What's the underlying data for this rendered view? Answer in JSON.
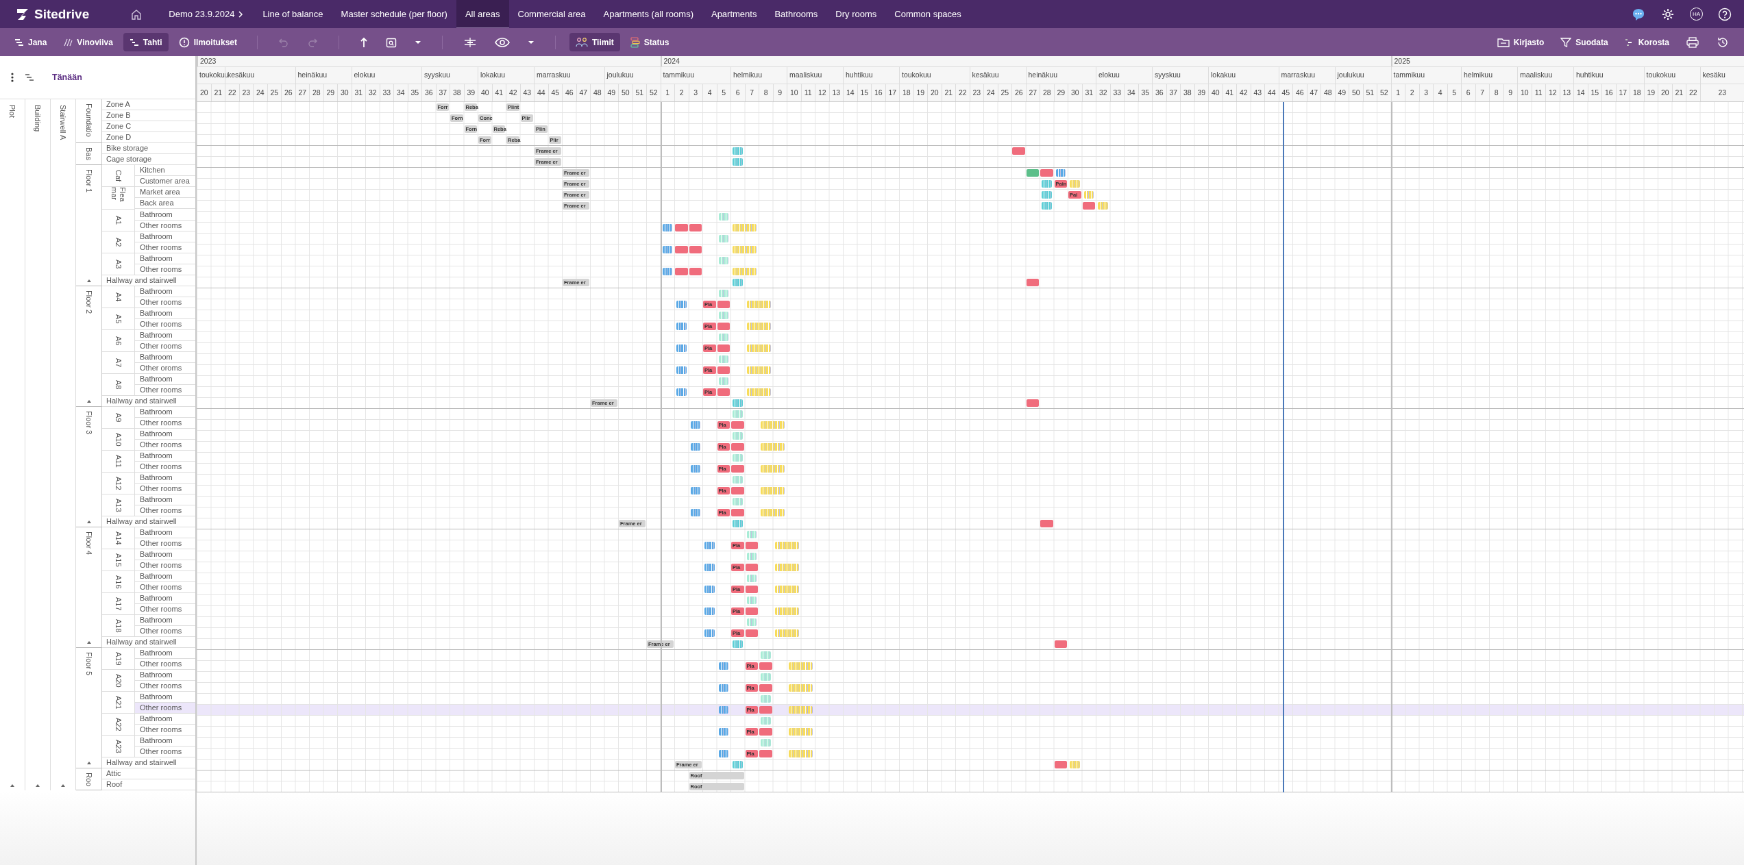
{
  "nav": {
    "logo": "Sitedrive",
    "project": "Demo 23.9.2024",
    "avatar": "HA",
    "tabs": [
      {
        "label": "Line of balance",
        "selected": false
      },
      {
        "label": "Master schedule (per floor)",
        "selected": false
      },
      {
        "label": "All areas",
        "selected": true
      },
      {
        "label": "Commercial area",
        "selected": false
      },
      {
        "label": "Apartments (all rooms)",
        "selected": false
      },
      {
        "label": "Apartments",
        "selected": false
      },
      {
        "label": "Bathrooms",
        "selected": false
      },
      {
        "label": "Dry rooms",
        "selected": false
      },
      {
        "label": "Common spaces",
        "selected": false
      }
    ]
  },
  "toolbar": {
    "views": [
      {
        "label": "Jana",
        "selected": false
      },
      {
        "label": "Vinoviiva",
        "selected": false
      },
      {
        "label": "Tahti",
        "selected": true
      },
      {
        "label": "Ilmoitukset",
        "selected": false
      }
    ],
    "undo": {
      "disabled": true
    },
    "redo": {
      "disabled": true
    },
    "filters": [
      {
        "label": "Tiimit",
        "selected": true
      },
      {
        "label": "Status",
        "selected": false
      }
    ],
    "right": [
      "Kirjasto",
      "Suodata",
      "Korosta"
    ]
  },
  "today_label": "Tänään",
  "timeline": [
    {
      "year": "2023",
      "months": [
        {
          "label": "toukokuu",
          "weeks": [
            "20",
            "21"
          ]
        },
        {
          "label": "kesäkuu",
          "weeks": [
            "22",
            "23",
            "24",
            "25",
            "26"
          ]
        },
        {
          "label": "heinäkuu",
          "weeks": [
            "27",
            "28",
            "29",
            "30"
          ]
        },
        {
          "label": "elokuu",
          "weeks": [
            "31",
            "32",
            "33",
            "34",
            "35"
          ]
        },
        {
          "label": "syyskuu",
          "weeks": [
            "36",
            "37",
            "38",
            "39"
          ]
        },
        {
          "label": "lokakuu",
          "weeks": [
            "40",
            "41",
            "42",
            "43"
          ]
        },
        {
          "label": "marraskuu",
          "weeks": [
            "44",
            "45",
            "46",
            "47",
            "48"
          ]
        },
        {
          "label": "joulukuu",
          "weeks": [
            "49",
            "50",
            "51",
            "52"
          ]
        }
      ]
    },
    {
      "year": "2024",
      "months": [
        {
          "label": "tammikuu",
          "weeks": [
            "1",
            "2",
            "3",
            "4",
            "5"
          ]
        },
        {
          "label": "helmikuu",
          "weeks": [
            "6",
            "7",
            "8",
            "9"
          ]
        },
        {
          "label": "maaliskuu",
          "weeks": [
            "10",
            "11",
            "12",
            "13"
          ]
        },
        {
          "label": "huhtikuu",
          "weeks": [
            "14",
            "15",
            "16",
            "17"
          ]
        },
        {
          "label": "toukokuu",
          "weeks": [
            "18",
            "19",
            "20",
            "21",
            "22"
          ]
        },
        {
          "label": "kesäkuu",
          "weeks": [
            "23",
            "24",
            "25",
            "26"
          ]
        },
        {
          "label": "heinäkuu",
          "weeks": [
            "27",
            "28",
            "29",
            "30",
            "31"
          ]
        },
        {
          "label": "elokuu",
          "weeks": [
            "32",
            "33",
            "34",
            "35"
          ]
        },
        {
          "label": "syyskuu",
          "weeks": [
            "36",
            "37",
            "38",
            "39"
          ]
        },
        {
          "label": "lokakuu",
          "weeks": [
            "40",
            "41",
            "42",
            "43",
            "44"
          ]
        },
        {
          "label": "marraskuu",
          "weeks": [
            "45",
            "46",
            "47",
            "48"
          ]
        },
        {
          "label": "joulukuu",
          "weeks": [
            "49",
            "50",
            "51",
            "52"
          ]
        }
      ]
    },
    {
      "year": "2025",
      "months": [
        {
          "label": "tammikuu",
          "weeks": [
            "1",
            "2",
            "3",
            "4",
            "5"
          ]
        },
        {
          "label": "helmikuu",
          "weeks": [
            "6",
            "7",
            "8",
            "9"
          ]
        },
        {
          "label": "maaliskuu",
          "weeks": [
            "10",
            "11",
            "12",
            "13"
          ]
        },
        {
          "label": "huhtikuu",
          "weeks": [
            "14",
            "15",
            "16",
            "17",
            "18"
          ]
        },
        {
          "label": "toukokuu",
          "weeks": [
            "19",
            "20",
            "21",
            "22"
          ]
        },
        {
          "label": "kesäku",
          "weeks": [
            "23"
          ]
        }
      ]
    }
  ],
  "tree": {
    "plot": "Plot",
    "building": "Building",
    "stairwell": "Stairwell A",
    "levels": [
      {
        "name": "Foundatio",
        "children": [
          {
            "name": "Zone A",
            "selected": false,
            "bars": [
              {
                "kind": "task",
                "color": "#d4d4d4",
                "label": "Forr"
              },
              {
                "kind": "task",
                "color": "#d4d4d4",
                "label": "Reba"
              },
              {
                "kind": "task",
                "color": "#d4d4d4",
                "label": "Plint"
              }
            ]
          },
          {
            "name": "Zone B",
            "selected": false,
            "bars": [
              {
                "kind": "task",
                "color": "#d4d4d4",
                "label": "Forn"
              },
              {
                "kind": "task",
                "color": "#d4d4d4",
                "label": "Conc"
              },
              {
                "kind": "task",
                "color": "#d4d4d4",
                "label": "Plir"
              }
            ]
          },
          {
            "name": "Zone C",
            "selected": false,
            "bars": [
              {
                "kind": "task",
                "color": "#d4d4d4",
                "label": "Forn"
              },
              {
                "kind": "task",
                "color": "#d4d4d4",
                "label": "Reba"
              },
              {
                "kind": "task",
                "color": "#d4d4d4",
                "label": "Plin"
              }
            ]
          },
          {
            "name": "Zone D",
            "selected": false,
            "bars": [
              {
                "kind": "task",
                "color": "#d4d4d4",
                "label": "Forr"
              },
              {
                "kind": "task",
                "color": "#d4d4d4",
                "label": "Reba"
              },
              {
                "kind": "task",
                "color": "#d4d4d4",
                "label": "Plir"
              }
            ]
          }
        ]
      },
      {
        "name": "Bas",
        "children": [
          {
            "name": "Bike storage",
            "selected": false,
            "bars": [
              {
                "kind": "task",
                "color": "#d4d4d4",
                "label": "Frame er"
              },
              {
                "kind": "stripes",
                "color": "#5ccfd6"
              },
              {
                "kind": "task",
                "color": "#f06c7c"
              }
            ]
          },
          {
            "name": "Cage storage",
            "selected": false,
            "bars": [
              {
                "kind": "task",
                "color": "#d4d4d4",
                "label": "Frame er"
              },
              {
                "kind": "stripes",
                "color": "#5ccfd6"
              }
            ]
          }
        ]
      },
      {
        "name": "Floor 1",
        "children": [
          {
            "name": "Caf",
            "children": [
              {
                "name": "Kitchen",
                "selected": false,
                "bars": [
                  {
                    "kind": "task",
                    "color": "#d4d4d4",
                    "label": "Frame er"
                  },
                  {
                    "kind": "task",
                    "color": "#5cbf8a"
                  },
                  {
                    "kind": "task",
                    "color": "#f06c7c"
                  },
                  {
                    "kind": "stripes",
                    "color": "#5aa9e6"
                  }
                ]
              },
              {
                "name": "Customer area",
                "selected": false,
                "bars": [
                  {
                    "kind": "task",
                    "color": "#d4d4d4",
                    "label": "Frame er"
                  },
                  {
                    "kind": "stripes",
                    "color": "#5ccfd6"
                  },
                  {
                    "kind": "task",
                    "color": "#f06c7c",
                    "label": "Pain"
                  },
                  {
                    "kind": "stripes",
                    "color": "#f7dc5c"
                  }
                ]
              }
            ]
          },
          {
            "name": "Flea mar",
            "children": [
              {
                "name": "Market area",
                "selected": false,
                "bars": [
                  {
                    "kind": "task",
                    "color": "#d4d4d4",
                    "label": "Frame er"
                  },
                  {
                    "kind": "stripes",
                    "color": "#5ccfd6"
                  },
                  {
                    "kind": "task",
                    "color": "#f06c7c",
                    "label": "Pai"
                  },
                  {
                    "kind": "stripes",
                    "color": "#f7dc5c"
                  }
                ]
              },
              {
                "name": "Back area",
                "selected": false,
                "bars": [
                  {
                    "kind": "task",
                    "color": "#d4d4d4",
                    "label": "Frame er"
                  },
                  {
                    "kind": "stripes",
                    "color": "#5ccfd6"
                  },
                  {
                    "kind": "task",
                    "color": "#f06c7c"
                  },
                  {
                    "kind": "stripes",
                    "color": "#f7dc5c"
                  }
                ]
              }
            ]
          },
          {
            "name": "A1",
            "children": [
              {
                "name": "Bathroom",
                "selected": false,
                "bars": [
                  {
                    "kind": "stripes",
                    "color": "#a8ecd6"
                  }
                ]
              },
              {
                "name": "Other rooms",
                "selected": false,
                "bars": [
                  {
                    "kind": "stripes",
                    "color": "#5aa9e6"
                  },
                  {
                    "kind": "task",
                    "color": "#f06c7c"
                  },
                  {
                    "kind": "task",
                    "color": "#f06c7c"
                  },
                  {
                    "kind": "stripes",
                    "color": "#f7dc5c"
                  }
                ]
              }
            ]
          },
          {
            "name": "A2",
            "children": [
              {
                "name": "Bathroom",
                "selected": false,
                "bars": [
                  {
                    "kind": "stripes",
                    "color": "#a8ecd6"
                  }
                ]
              },
              {
                "name": "Other rooms",
                "selected": false,
                "bars": [
                  {
                    "kind": "stripes",
                    "color": "#5aa9e6"
                  },
                  {
                    "kind": "task",
                    "color": "#f06c7c"
                  },
                  {
                    "kind": "task",
                    "color": "#f06c7c"
                  },
                  {
                    "kind": "stripes",
                    "color": "#f7dc5c"
                  }
                ]
              }
            ]
          },
          {
            "name": "A3",
            "children": [
              {
                "name": "Bathroom",
                "selected": false,
                "bars": [
                  {
                    "kind": "stripes",
                    "color": "#a8ecd6"
                  }
                ]
              },
              {
                "name": "Other rooms",
                "selected": false,
                "bars": [
                  {
                    "kind": "stripes",
                    "color": "#5aa9e6"
                  },
                  {
                    "kind": "task",
                    "color": "#f06c7c"
                  },
                  {
                    "kind": "task",
                    "color": "#f06c7c"
                  },
                  {
                    "kind": "stripes",
                    "color": "#f7dc5c"
                  }
                ]
              }
            ]
          },
          {
            "name": "Hallway and stairwell",
            "selected": false,
            "bars": [
              {
                "kind": "task",
                "color": "#d4d4d4",
                "label": "Frame er"
              },
              {
                "kind": "stripes",
                "color": "#5ccfd6"
              },
              {
                "kind": "task",
                "color": "#f06c7c"
              }
            ]
          }
        ]
      },
      {
        "name": "Floor 2",
        "children": [
          {
            "name": "A4",
            "children": [
              {
                "name": "Bathroom",
                "selected": false,
                "bars": [
                  {
                    "kind": "stripes",
                    "color": "#a8ecd6"
                  }
                ]
              },
              {
                "name": "Other rooms",
                "selected": false,
                "bars": [
                  {
                    "kind": "stripes",
                    "color": "#5aa9e6"
                  },
                  {
                    "kind": "task",
                    "color": "#f06c7c",
                    "label": "Pla"
                  },
                  {
                    "kind": "task",
                    "color": "#f06c7c"
                  },
                  {
                    "kind": "stripes",
                    "color": "#f7dc5c"
                  }
                ]
              }
            ]
          },
          {
            "name": "A5",
            "children": [
              {
                "name": "Bathroom",
                "selected": false,
                "bars": [
                  {
                    "kind": "stripes",
                    "color": "#a8ecd6"
                  }
                ]
              },
              {
                "name": "Other rooms",
                "selected": false,
                "bars": [
                  {
                    "kind": "stripes",
                    "color": "#5aa9e6"
                  },
                  {
                    "kind": "task",
                    "color": "#f06c7c",
                    "label": "Pla"
                  },
                  {
                    "kind": "task",
                    "color": "#f06c7c"
                  },
                  {
                    "kind": "stripes",
                    "color": "#f7dc5c"
                  }
                ]
              }
            ]
          },
          {
            "name": "A6",
            "children": [
              {
                "name": "Bathroom",
                "selected": false,
                "bars": [
                  {
                    "kind": "stripes",
                    "color": "#a8ecd6"
                  }
                ]
              },
              {
                "name": "Other rooms",
                "selected": false,
                "bars": [
                  {
                    "kind": "stripes",
                    "color": "#5aa9e6"
                  },
                  {
                    "kind": "task",
                    "color": "#f06c7c",
                    "label": "Pla"
                  },
                  {
                    "kind": "task",
                    "color": "#f06c7c"
                  },
                  {
                    "kind": "stripes",
                    "color": "#f7dc5c"
                  }
                ]
              }
            ]
          },
          {
            "name": "A7",
            "children": [
              {
                "name": "Bathroom",
                "selected": false,
                "bars": [
                  {
                    "kind": "stripes",
                    "color": "#a8ecd6"
                  }
                ]
              },
              {
                "name": "Other oroms",
                "selected": false,
                "bars": [
                  {
                    "kind": "stripes",
                    "color": "#5aa9e6"
                  },
                  {
                    "kind": "task",
                    "color": "#f06c7c",
                    "label": "Pla"
                  },
                  {
                    "kind": "task",
                    "color": "#f06c7c"
                  },
                  {
                    "kind": "stripes",
                    "color": "#f7dc5c"
                  }
                ]
              }
            ]
          },
          {
            "name": "A8",
            "children": [
              {
                "name": "Bathroom",
                "selected": false,
                "bars": [
                  {
                    "kind": "stripes",
                    "color": "#a8ecd6"
                  }
                ]
              },
              {
                "name": "Other rooms",
                "selected": false,
                "bars": [
                  {
                    "kind": "stripes",
                    "color": "#5aa9e6"
                  },
                  {
                    "kind": "task",
                    "color": "#f06c7c",
                    "label": "Pla"
                  },
                  {
                    "kind": "task",
                    "color": "#f06c7c"
                  },
                  {
                    "kind": "stripes",
                    "color": "#f7dc5c"
                  }
                ]
              }
            ]
          },
          {
            "name": "Hallway and stairwell",
            "selected": false,
            "bars": [
              {
                "kind": "task",
                "color": "#d4d4d4",
                "label": "Frame er"
              },
              {
                "kind": "stripes",
                "color": "#5ccfd6"
              },
              {
                "kind": "task",
                "color": "#f06c7c"
              }
            ]
          }
        ]
      },
      {
        "name": "Floor 3",
        "children": [
          {
            "name": "A9",
            "children": [
              {
                "name": "Bathroom",
                "selected": false,
                "bars": [
                  {
                    "kind": "stripes",
                    "color": "#a8ecd6"
                  }
                ]
              },
              {
                "name": "Other rooms",
                "selected": false,
                "bars": [
                  {
                    "kind": "stripes",
                    "color": "#5aa9e6"
                  },
                  {
                    "kind": "task",
                    "color": "#f06c7c",
                    "label": "Pla"
                  },
                  {
                    "kind": "task",
                    "color": "#f06c7c"
                  },
                  {
                    "kind": "stripes",
                    "color": "#f7dc5c"
                  }
                ]
              }
            ]
          },
          {
            "name": "A10",
            "children": [
              {
                "name": "Bathroom",
                "selected": false,
                "bars": [
                  {
                    "kind": "stripes",
                    "color": "#a8ecd6"
                  }
                ]
              },
              {
                "name": "Other rooms",
                "selected": false,
                "bars": [
                  {
                    "kind": "stripes",
                    "color": "#5aa9e6"
                  },
                  {
                    "kind": "task",
                    "color": "#f06c7c",
                    "label": "Pla"
                  },
                  {
                    "kind": "task",
                    "color": "#f06c7c"
                  },
                  {
                    "kind": "stripes",
                    "color": "#f7dc5c"
                  }
                ]
              }
            ]
          },
          {
            "name": "A11",
            "children": [
              {
                "name": "Bathroom",
                "selected": false,
                "bars": [
                  {
                    "kind": "stripes",
                    "color": "#a8ecd6"
                  }
                ]
              },
              {
                "name": "Other rooms",
                "selected": false,
                "bars": [
                  {
                    "kind": "stripes",
                    "color": "#5aa9e6"
                  },
                  {
                    "kind": "task",
                    "color": "#f06c7c",
                    "label": "Pla"
                  },
                  {
                    "kind": "task",
                    "color": "#f06c7c"
                  },
                  {
                    "kind": "stripes",
                    "color": "#f7dc5c"
                  }
                ]
              }
            ]
          },
          {
            "name": "A12",
            "children": [
              {
                "name": "Bathroom",
                "selected": false,
                "bars": [
                  {
                    "kind": "stripes",
                    "color": "#a8ecd6"
                  }
                ]
              },
              {
                "name": "Other rooms",
                "selected": false,
                "bars": [
                  {
                    "kind": "stripes",
                    "color": "#5aa9e6"
                  },
                  {
                    "kind": "task",
                    "color": "#f06c7c",
                    "label": "Pla"
                  },
                  {
                    "kind": "task",
                    "color": "#f06c7c"
                  },
                  {
                    "kind": "stripes",
                    "color": "#f7dc5c"
                  }
                ]
              }
            ]
          },
          {
            "name": "A13",
            "children": [
              {
                "name": "Bathroom",
                "selected": false,
                "bars": [
                  {
                    "kind": "stripes",
                    "color": "#a8ecd6"
                  }
                ]
              },
              {
                "name": "Other rooms",
                "selected": false,
                "bars": [
                  {
                    "kind": "stripes",
                    "color": "#5aa9e6"
                  },
                  {
                    "kind": "task",
                    "color": "#f06c7c",
                    "label": "Pla"
                  },
                  {
                    "kind": "task",
                    "color": "#f06c7c"
                  },
                  {
                    "kind": "stripes",
                    "color": "#f7dc5c"
                  }
                ]
              }
            ]
          },
          {
            "name": "Hallway and stairwell",
            "selected": false,
            "bars": [
              {
                "kind": "task",
                "color": "#d4d4d4",
                "label": "Frame er"
              },
              {
                "kind": "stripes",
                "color": "#5ccfd6"
              },
              {
                "kind": "task",
                "color": "#f06c7c"
              }
            ]
          }
        ]
      },
      {
        "name": "Floor 4",
        "children": [
          {
            "name": "A14",
            "children": [
              {
                "name": "Bathroom",
                "selected": false,
                "bars": [
                  {
                    "kind": "stripes",
                    "color": "#a8ecd6"
                  }
                ]
              },
              {
                "name": "Other rooms",
                "selected": false,
                "bars": [
                  {
                    "kind": "stripes",
                    "color": "#5aa9e6"
                  },
                  {
                    "kind": "task",
                    "color": "#f06c7c",
                    "label": "Pla"
                  },
                  {
                    "kind": "task",
                    "color": "#f06c7c"
                  },
                  {
                    "kind": "stripes",
                    "color": "#f7dc5c"
                  }
                ]
              }
            ]
          },
          {
            "name": "A15",
            "children": [
              {
                "name": "Bathroom",
                "selected": false,
                "bars": [
                  {
                    "kind": "stripes",
                    "color": "#a8ecd6"
                  }
                ]
              },
              {
                "name": "Other rooms",
                "selected": false,
                "bars": [
                  {
                    "kind": "stripes",
                    "color": "#5aa9e6"
                  },
                  {
                    "kind": "task",
                    "color": "#f06c7c",
                    "label": "Pla"
                  },
                  {
                    "kind": "task",
                    "color": "#f06c7c"
                  },
                  {
                    "kind": "stripes",
                    "color": "#f7dc5c"
                  }
                ]
              }
            ]
          },
          {
            "name": "A16",
            "children": [
              {
                "name": "Bathroom",
                "selected": false,
                "bars": [
                  {
                    "kind": "stripes",
                    "color": "#a8ecd6"
                  }
                ]
              },
              {
                "name": "Other rooms",
                "selected": false,
                "bars": [
                  {
                    "kind": "stripes",
                    "color": "#5aa9e6"
                  },
                  {
                    "kind": "task",
                    "color": "#f06c7c",
                    "label": "Pla"
                  },
                  {
                    "kind": "task",
                    "color": "#f06c7c"
                  },
                  {
                    "kind": "stripes",
                    "color": "#f7dc5c"
                  }
                ]
              }
            ]
          },
          {
            "name": "A17",
            "children": [
              {
                "name": "Bathroom",
                "selected": false,
                "bars": [
                  {
                    "kind": "stripes",
                    "color": "#a8ecd6"
                  }
                ]
              },
              {
                "name": "Other rooms",
                "selected": false,
                "bars": [
                  {
                    "kind": "stripes",
                    "color": "#5aa9e6"
                  },
                  {
                    "kind": "task",
                    "color": "#f06c7c",
                    "label": "Pla"
                  },
                  {
                    "kind": "task",
                    "color": "#f06c7c"
                  },
                  {
                    "kind": "stripes",
                    "color": "#f7dc5c"
                  }
                ]
              }
            ]
          },
          {
            "name": "A18",
            "children": [
              {
                "name": "Bathroom",
                "selected": false,
                "bars": [
                  {
                    "kind": "stripes",
                    "color": "#a8ecd6"
                  }
                ]
              },
              {
                "name": "Other rooms",
                "selected": false,
                "bars": [
                  {
                    "kind": "stripes",
                    "color": "#5aa9e6"
                  },
                  {
                    "kind": "task",
                    "color": "#f06c7c",
                    "label": "Pla"
                  },
                  {
                    "kind": "task",
                    "color": "#f06c7c"
                  },
                  {
                    "kind": "stripes",
                    "color": "#f7dc5c"
                  }
                ]
              }
            ]
          },
          {
            "name": "Hallway and stairwell",
            "selected": false,
            "bars": [
              {
                "kind": "task",
                "color": "#d4d4d4",
                "label": "Frame er"
              },
              {
                "kind": "stripes",
                "color": "#5ccfd6"
              },
              {
                "kind": "task",
                "color": "#f06c7c"
              }
            ]
          }
        ]
      },
      {
        "name": "Floor 5",
        "children": [
          {
            "name": "A19",
            "children": [
              {
                "name": "Bathroom",
                "selected": false,
                "bars": [
                  {
                    "kind": "stripes",
                    "color": "#a8ecd6"
                  }
                ]
              },
              {
                "name": "Other rooms",
                "selected": false,
                "bars": [
                  {
                    "kind": "stripes",
                    "color": "#5aa9e6"
                  },
                  {
                    "kind": "task",
                    "color": "#f06c7c",
                    "label": "Pla"
                  },
                  {
                    "kind": "task",
                    "color": "#f06c7c"
                  },
                  {
                    "kind": "stripes",
                    "color": "#f7dc5c"
                  }
                ]
              }
            ]
          },
          {
            "name": "A20",
            "children": [
              {
                "name": "Bathroom",
                "selected": false,
                "bars": [
                  {
                    "kind": "stripes",
                    "color": "#a8ecd6"
                  }
                ]
              },
              {
                "name": "Other rooms",
                "selected": false,
                "bars": [
                  {
                    "kind": "stripes",
                    "color": "#5aa9e6"
                  },
                  {
                    "kind": "task",
                    "color": "#f06c7c",
                    "label": "Pla"
                  },
                  {
                    "kind": "task",
                    "color": "#f06c7c"
                  },
                  {
                    "kind": "stripes",
                    "color": "#f7dc5c"
                  }
                ]
              }
            ]
          },
          {
            "name": "A21",
            "children": [
              {
                "name": "Bathroom",
                "selected": false,
                "bars": [
                  {
                    "kind": "stripes",
                    "color": "#a8ecd6"
                  }
                ]
              },
              {
                "name": "Other rooms",
                "selected": true,
                "bars": [
                  {
                    "kind": "stripes",
                    "color": "#5aa9e6"
                  },
                  {
                    "kind": "task",
                    "color": "#f06c7c",
                    "label": "Pla"
                  },
                  {
                    "kind": "task",
                    "color": "#f06c7c"
                  },
                  {
                    "kind": "stripes",
                    "color": "#f7dc5c"
                  }
                ]
              }
            ]
          },
          {
            "name": "A22",
            "children": [
              {
                "name": "Bathroom",
                "selected": false,
                "bars": [
                  {
                    "kind": "stripes",
                    "color": "#a8ecd6"
                  }
                ]
              },
              {
                "name": "Other rooms",
                "selected": false,
                "bars": [
                  {
                    "kind": "stripes",
                    "color": "#5aa9e6"
                  },
                  {
                    "kind": "task",
                    "color": "#f06c7c",
                    "label": "Pla"
                  },
                  {
                    "kind": "task",
                    "color": "#f06c7c"
                  },
                  {
                    "kind": "stripes",
                    "color": "#f7dc5c"
                  }
                ]
              }
            ]
          },
          {
            "name": "A23",
            "children": [
              {
                "name": "Bathroom",
                "selected": false,
                "bars": [
                  {
                    "kind": "stripes",
                    "color": "#a8ecd6"
                  }
                ]
              },
              {
                "name": "Other rooms",
                "selected": false,
                "bars": [
                  {
                    "kind": "stripes",
                    "color": "#5aa9e6"
                  },
                  {
                    "kind": "task",
                    "color": "#f06c7c",
                    "label": "Pla"
                  },
                  {
                    "kind": "task",
                    "color": "#f06c7c"
                  },
                  {
                    "kind": "stripes",
                    "color": "#f7dc5c"
                  }
                ]
              }
            ]
          },
          {
            "name": "Hallway and stairwell",
            "selected": false,
            "bars": [
              {
                "kind": "task",
                "color": "#d4d4d4",
                "label": "Frame er"
              },
              {
                "kind": "stripes",
                "color": "#5ccfd6"
              },
              {
                "kind": "task",
                "color": "#f06c7c"
              },
              {
                "kind": "stripes",
                "color": "#f7dc5c"
              }
            ]
          }
        ]
      },
      {
        "name": "Roo",
        "children": [
          {
            "name": "Attic",
            "selected": false,
            "bars": [
              {
                "kind": "task",
                "color": "#d4d4d4",
                "label": "Roof"
              }
            ]
          },
          {
            "name": "Roof",
            "selected": false,
            "bars": [
              {
                "kind": "task",
                "color": "#d4d4d4",
                "label": "Roof"
              }
            ]
          }
        ]
      }
    ]
  }
}
